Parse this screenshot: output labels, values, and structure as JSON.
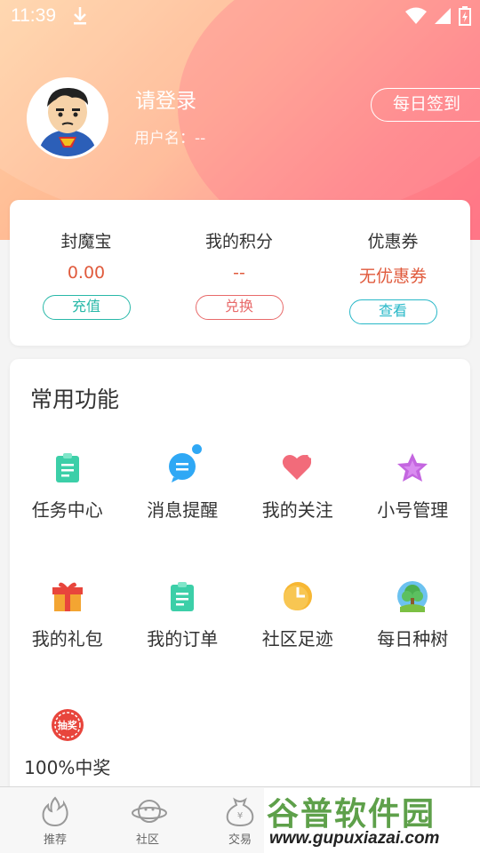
{
  "status": {
    "time": "11:39"
  },
  "profile": {
    "title": "请登录",
    "username": "用户名：--"
  },
  "header": {
    "checkin_label": "每日签到"
  },
  "wallet": [
    {
      "label": "封魔宝",
      "value": "0.00",
      "button": "充值",
      "value_color": "#e05a3c",
      "button_color": "#28b8a8"
    },
    {
      "label": "我的积分",
      "value": "--",
      "button": "兑换",
      "value_color": "#e05a3c",
      "button_color": "#e86a6a"
    },
    {
      "label": "优惠券",
      "value": "无优惠券",
      "button": "查看",
      "value_color": "#e05a3c",
      "button_color": "#28b8c8"
    }
  ],
  "functions": {
    "title": "常用功能",
    "items": [
      {
        "label": "任务中心",
        "icon": "task-icon"
      },
      {
        "label": "消息提醒",
        "icon": "message-icon"
      },
      {
        "label": "我的关注",
        "icon": "heart-icon"
      },
      {
        "label": "小号管理",
        "icon": "star-icon"
      },
      {
        "label": "我的礼包",
        "icon": "gift-icon"
      },
      {
        "label": "我的订单",
        "icon": "order-icon"
      },
      {
        "label": "社区足迹",
        "icon": "clock-icon"
      },
      {
        "label": "每日种树",
        "icon": "tree-icon"
      },
      {
        "label": "100%中奖",
        "icon": "lottery-icon",
        "icon_text": "抽奖"
      }
    ]
  },
  "tabs": [
    {
      "label": "推荐",
      "icon": "flame-icon"
    },
    {
      "label": "社区",
      "icon": "planet-icon"
    },
    {
      "label": "交易",
      "icon": "money-bag-icon"
    }
  ],
  "watermark": {
    "top": "谷普软件园",
    "bottom": "www.gupuxiazai.com"
  }
}
